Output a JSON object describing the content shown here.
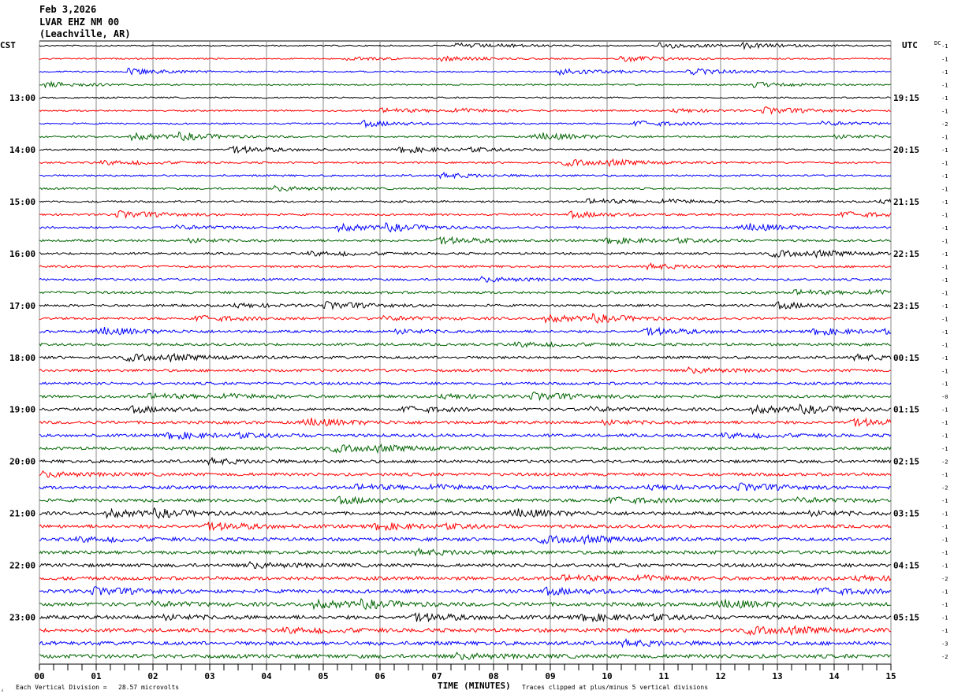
{
  "header": {
    "date": "Feb 3,2026",
    "station": "LVAR EHZ NM 00",
    "location": "(Leachville, AR)"
  },
  "chart_data": {
    "type": "line",
    "title": "Feb 3,2026 LVAR EHZ NM 00 (Leachville, AR)",
    "left_timezone": "CST",
    "right_timezone": "UTC",
    "dc_header": "DC",
    "xlabel": "TIME (MINUTES)",
    "x_ticks": [
      "00",
      "01",
      "02",
      "03",
      "04",
      "05",
      "06",
      "07",
      "08",
      "09",
      "10",
      "11",
      "12",
      "13",
      "14",
      "15"
    ],
    "xlim": [
      0,
      15
    ],
    "minor_ticks_per_minute": 4,
    "grid": true,
    "trace_minutes": 15,
    "trace_colors": [
      "#000000",
      "#ff0000",
      "#0000ff",
      "#006400"
    ],
    "left_hour_labels": [
      "13:00",
      "14:00",
      "15:00",
      "16:00",
      "17:00",
      "18:00",
      "19:00",
      "20:00",
      "21:00",
      "22:00",
      "23:00"
    ],
    "right_hour_labels": [
      "19:15",
      "20:15",
      "21:15",
      "22:15",
      "23:15",
      "00:15",
      "01:15",
      "02:15",
      "03:15",
      "04:15",
      "05:15"
    ],
    "dc_offsets": [
      "-1",
      "-1",
      "-1",
      "-1",
      "-1",
      "-1",
      "-2",
      "-1",
      "-1",
      "-1",
      "-1",
      "-1",
      "-1",
      "-1",
      "-1",
      "-1",
      "-1",
      "-1",
      "-1",
      "-1",
      "-1",
      "-1",
      "-1",
      "-1",
      "-1",
      "-1",
      "-1",
      "-0",
      "-1",
      "-1",
      "-1",
      "-1",
      "-2",
      "-1",
      "-2",
      "-1",
      "-1",
      "-1",
      "-1",
      "-1",
      "-1",
      "-2",
      "-1",
      "-1",
      "-1",
      "-1",
      "-3",
      "-2"
    ],
    "scale_note": "Each Vertical Division =   28.57 microvolts",
    "clip_note": "Traces clipped at plus/minus 5 vertical divisions"
  }
}
